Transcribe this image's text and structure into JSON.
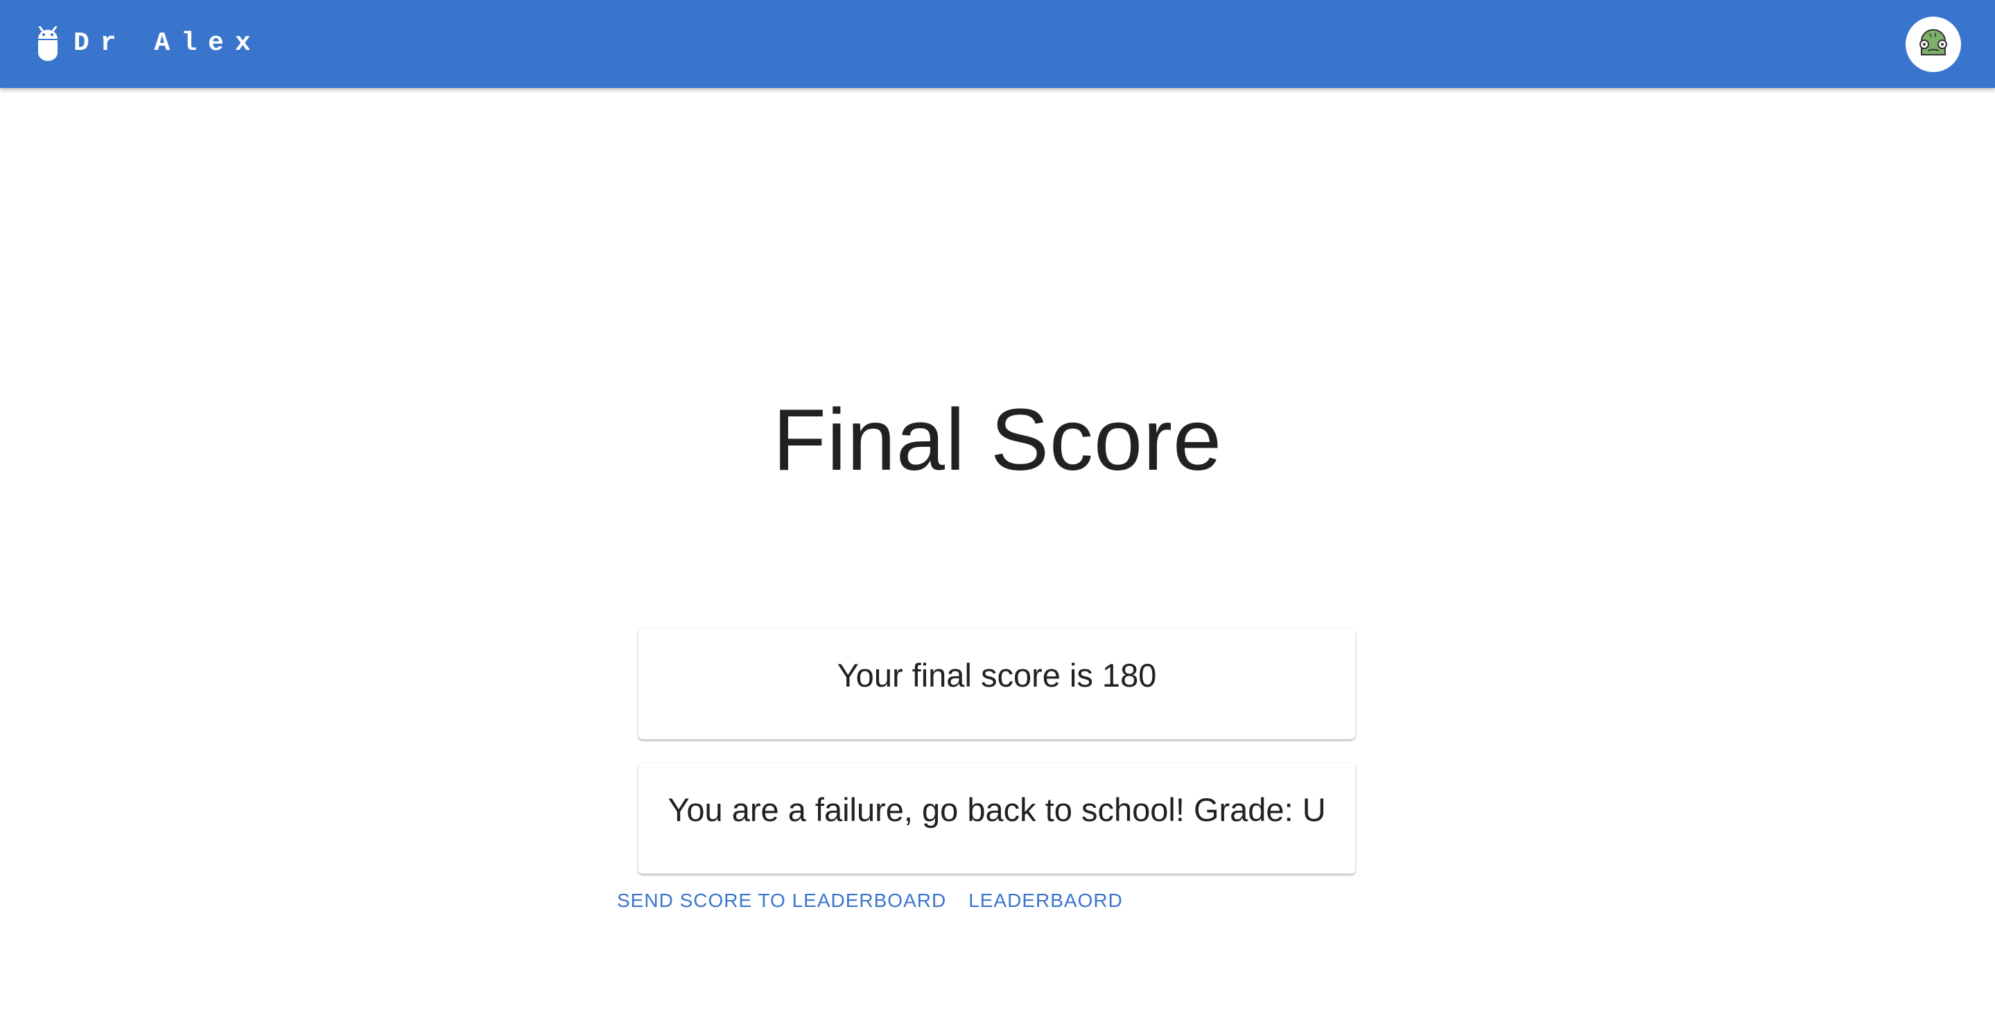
{
  "app": {
    "title": "Dr Alex",
    "brand_icon": "robot-icon",
    "avatar_icon": "user-avatar-icon",
    "colors": {
      "primary": "#3a75cd",
      "text": "#212121",
      "background": "#ffffff"
    }
  },
  "main": {
    "page_title": "Final Score",
    "score_text": "Your final score is 180",
    "grade_text": "You are a failure, go back to school! Grade: U"
  },
  "actions": {
    "send_label": "SEND SCORE TO LEADERBOARD",
    "leaderboard_label": "LEADERBAORD"
  }
}
